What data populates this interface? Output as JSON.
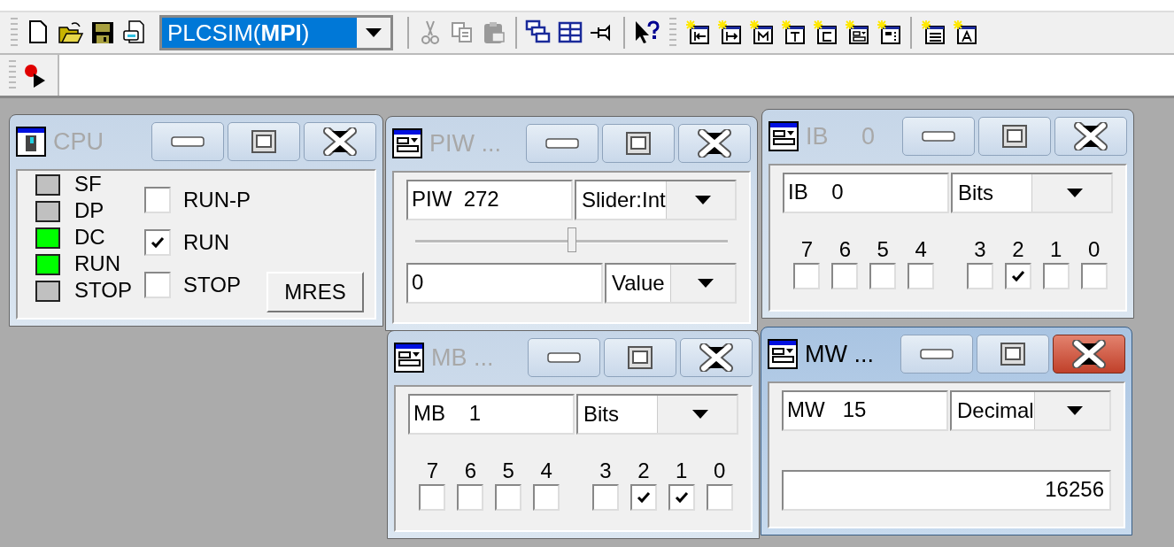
{
  "toolbar": {
    "connection": "PLCSIM(**MPI**)"
  },
  "windows": [
    {
      "kind": "cpu",
      "title": "CPU",
      "active": false,
      "leds": [
        {
          "label": "SF",
          "on": false
        },
        {
          "label": "DP",
          "on": false
        },
        {
          "label": "DC",
          "on": true
        },
        {
          "label": "RUN",
          "on": true
        },
        {
          "label": "STOP",
          "on": false
        }
      ],
      "modes": [
        {
          "label": "RUN-P",
          "checked": false
        },
        {
          "label": "RUN",
          "checked": true
        },
        {
          "label": "STOP",
          "checked": false
        }
      ],
      "button": "MRES"
    },
    {
      "kind": "slider",
      "title": "PIW ...",
      "active": false,
      "address": "PIW  272",
      "format": "Slider:Int",
      "level": 0.5,
      "value": "0",
      "value_format": "Value"
    },
    {
      "kind": "bits",
      "title": "IB     0",
      "active": false,
      "address": "IB    0",
      "format": "Bits",
      "bits": [
        {
          "label": "7",
          "checked": false
        },
        {
          "label": "6",
          "checked": false
        },
        {
          "label": "5",
          "checked": false
        },
        {
          "label": "4",
          "checked": false
        },
        {
          "label": "3",
          "checked": false
        },
        {
          "label": "2",
          "checked": true
        },
        {
          "label": "1",
          "checked": false
        },
        {
          "label": "0",
          "checked": false
        }
      ]
    },
    {
      "kind": "bits",
      "title": "MB ...",
      "active": false,
      "address": "MB    1",
      "format": "Bits",
      "bits": [
        {
          "label": "7",
          "checked": false
        },
        {
          "label": "6",
          "checked": false
        },
        {
          "label": "5",
          "checked": false
        },
        {
          "label": "4",
          "checked": false
        },
        {
          "label": "3",
          "checked": false
        },
        {
          "label": "2",
          "checked": true
        },
        {
          "label": "1",
          "checked": true
        },
        {
          "label": "0",
          "checked": false
        }
      ]
    },
    {
      "kind": "value",
      "title": "MW ...",
      "active": true,
      "address": "MW   15",
      "format": "Decimal",
      "value": "16256"
    }
  ]
}
